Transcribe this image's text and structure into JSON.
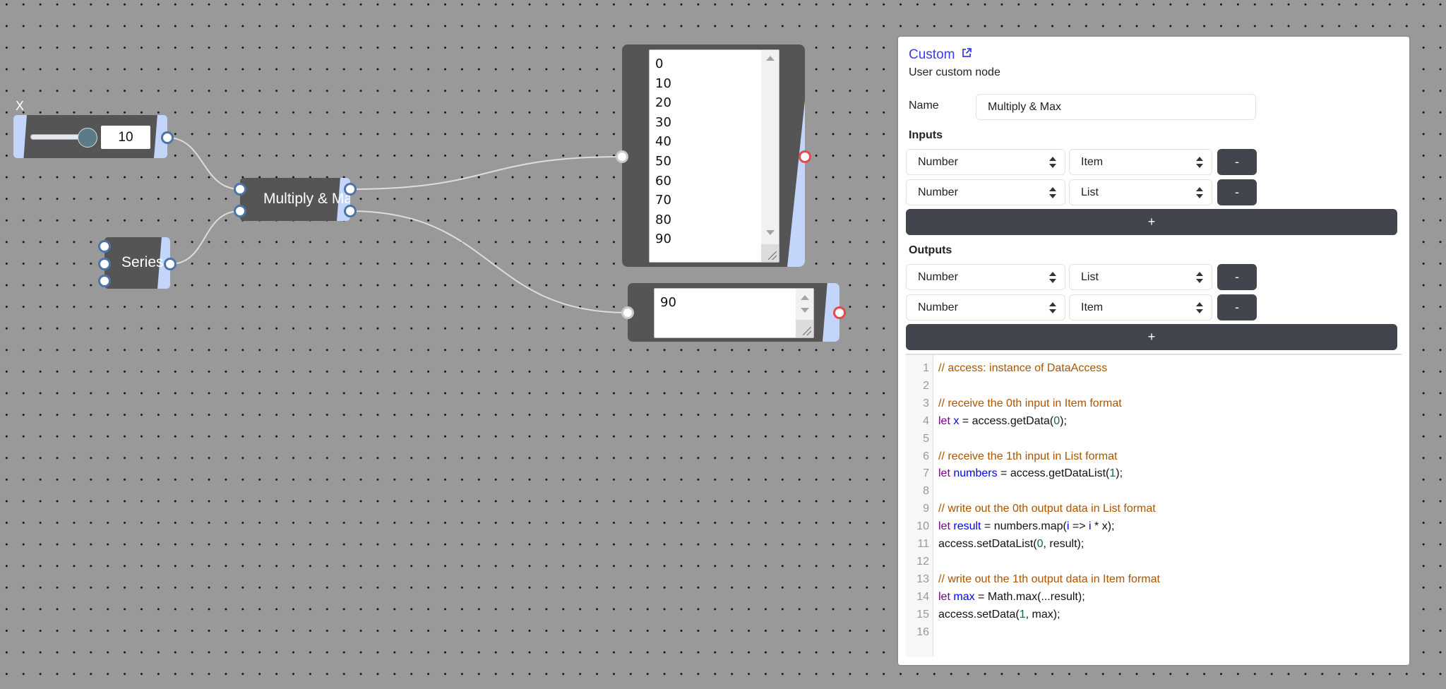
{
  "canvas": {
    "slider_node": {
      "label": "X",
      "value": "10",
      "slider_fraction": 0.85
    },
    "multiply_node": {
      "label": "Multiply & Max"
    },
    "series_node": {
      "label": "Series"
    },
    "list_output_node": {
      "values": [
        "0",
        "10",
        "20",
        "30",
        "40",
        "50",
        "60",
        "70",
        "80",
        "90"
      ]
    },
    "item_output_node": {
      "value": "90"
    }
  },
  "panel": {
    "title": "Custom",
    "title_icon": "external-link-icon",
    "subtitle": "User custom node",
    "name_label": "Name",
    "name_value": "Multiply & Max",
    "inputs_heading": "Inputs",
    "inputs": [
      {
        "type": "Number",
        "access": "Item",
        "remove_label": "-"
      },
      {
        "type": "Number",
        "access": "List",
        "remove_label": "-"
      }
    ],
    "add_input_label": "+",
    "outputs_heading": "Outputs",
    "outputs": [
      {
        "type": "Number",
        "access": "List",
        "remove_label": "-"
      },
      {
        "type": "Number",
        "access": "Item",
        "remove_label": "-"
      }
    ],
    "add_output_label": "+",
    "code_lines": [
      "// access: instance of DataAccess",
      "",
      "// receive the 0th input in Item format",
      "let x = access.getData(0);",
      "",
      "// receive the 1th input in List format",
      "let numbers = access.getDataList(1);",
      "",
      "// write out the 0th output data in List format",
      "let result = numbers.map(i => i * x);",
      "access.setDataList(0, result);",
      "",
      "// write out the 1th output data in Item format",
      "let max = Math.max(...result);",
      "access.setData(1, max);",
      ""
    ]
  },
  "colors": {
    "accent": "#3b3bf0",
    "node_body": "#555555",
    "node_band": "#c3d5fb",
    "button": "#42454d",
    "comment": "#aa5500",
    "keyword": "#770088",
    "def": "#0000ff",
    "number": "#116644"
  }
}
